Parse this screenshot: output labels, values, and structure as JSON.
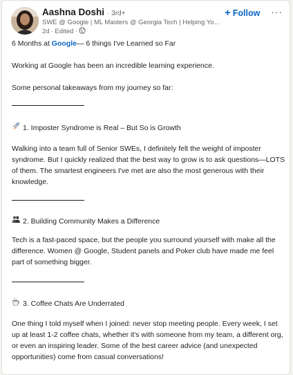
{
  "post": {
    "author": {
      "name": "Aashna Doshi",
      "degree": "· 3rd+",
      "headline": "SWE @ Google | ML Masters @ Georgia Tech | Helping You Brea...",
      "time": "2d",
      "edited": "· Edited ·",
      "visibility_icon": "globe-icon"
    },
    "actions": {
      "follow_label": "Follow",
      "more_label": "···"
    },
    "content": {
      "title_prefix": "6 Months at ",
      "title_link": "Google",
      "title_suffix": "— 6 things I've Learned so Far",
      "intro": "Working at Google has been an incredible learning experience.",
      "takeaways_intro": "Some personal takeaways from my journey so far:",
      "sections": [
        {
          "icon": "rocket-icon",
          "heading": "1. Imposter Syndrome is Real – But So is Growth",
          "text": "Walking into a team full of Senior SWEs, I definitely felt the weight of imposter syndrome. But I quickly realized that the best way to grow is to ask questions—LOTS of them. The smartest engineers I've met are also the most generous with their knowledge."
        },
        {
          "icon": "people-icon",
          "heading": "2. Building Community Makes a Difference",
          "text": "Tech is a fast-paced space, but the people you surround yourself with make all the difference. Women @ Google, Student panels and Poker club have made me feel part of something bigger."
        },
        {
          "icon": "coffee-icon",
          "heading": "3. Coffee Chats Are Underrated",
          "text": "One thing I told myself when I joined: never stop meeting people. Every week, I set up at least 1-2 coffee chats, whether it's with someone from my team, a different org, or even an inspiring leader. Some of the best career advice (and unexpected opportunities) come from casual conversations!"
        }
      ]
    },
    "colors": {
      "link": "#0a66c2",
      "text": "#1f1f1f",
      "muted": "#666666"
    }
  }
}
